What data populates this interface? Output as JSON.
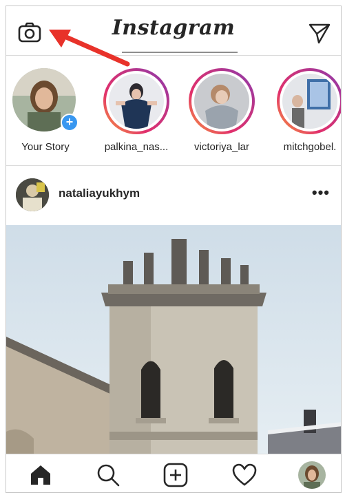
{
  "header": {
    "brand": "Instagram",
    "camera_icon": "camera-icon",
    "direct_icon": "paper-plane-icon"
  },
  "annotation": {
    "arrow_color": "#e8322a"
  },
  "stories": [
    {
      "name": "Your Story",
      "own": true
    },
    {
      "name": "palkina_nas...",
      "own": false
    },
    {
      "name": "victoriya_lar",
      "own": false
    },
    {
      "name": "mitchgobel.",
      "own": false
    }
  ],
  "post": {
    "username": "nataliayukhym",
    "more_label": "•••"
  },
  "tabbar": {
    "items": [
      "home-icon",
      "search-icon",
      "add-post-icon",
      "heart-icon",
      "profile-avatar"
    ],
    "active": "home-icon"
  },
  "colors": {
    "story_gradient": [
      "#f9a23b",
      "#e1306c",
      "#c13584",
      "#833ab4"
    ],
    "add_story_badge": "#3897f0"
  }
}
